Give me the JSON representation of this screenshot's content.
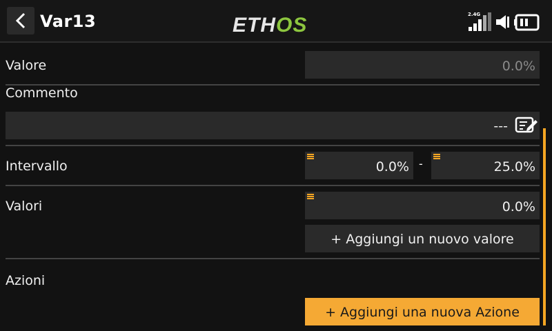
{
  "header": {
    "title": "Var13",
    "logo_left": "ETH",
    "logo_right": "OS",
    "rf_band": "2.4G",
    "icons": [
      "back-arrow-icon",
      "signal-bars-icon",
      "speaker-icon",
      "battery-icon"
    ]
  },
  "rows": {
    "valore": {
      "label": "Valore",
      "value": "0.0%"
    },
    "commento": {
      "label": "Commento",
      "value": "---"
    },
    "intervallo": {
      "label": "Intervallo",
      "min": "0.0%",
      "dash": "-",
      "max": "25.0%"
    },
    "valori": {
      "label": "Valori",
      "value": "0.0%",
      "add_button": "+ Aggiungi un nuovo valore"
    },
    "azioni": {
      "label": "Azioni",
      "add_button": "+ Aggiungi una nuova Azione"
    }
  },
  "colors": {
    "accent": "#f5a623",
    "logo_green": "#8dc63f",
    "background": "#121212",
    "field": "#2a2a2a"
  }
}
